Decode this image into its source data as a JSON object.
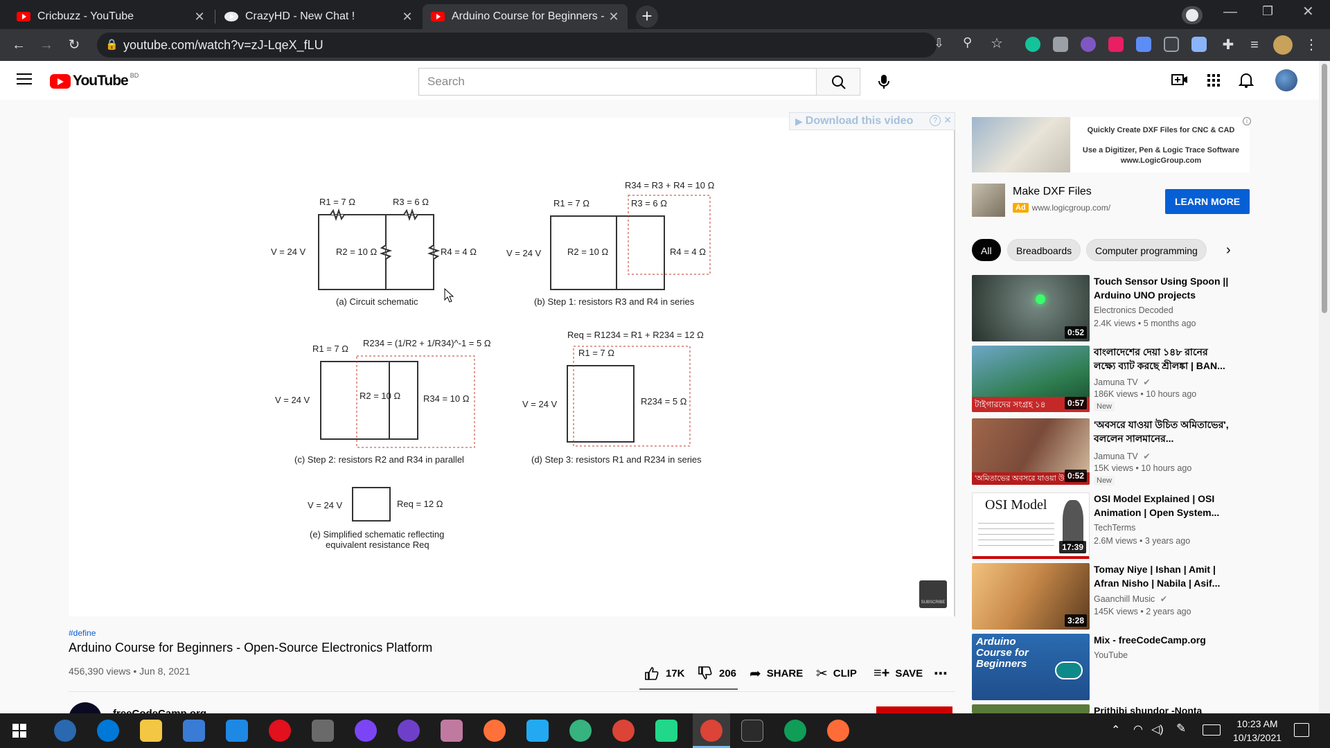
{
  "tabs": [
    {
      "title": "Cricbuzz - YouTube"
    },
    {
      "title": "CrazyHD - New Chat !"
    },
    {
      "title": "Arduino Course for Beginners - O"
    }
  ],
  "omnibox": {
    "url": "youtube.com/watch?v=zJ-LqeX_fLU"
  },
  "youtube": {
    "logo": "YouTube",
    "region": "BD",
    "search_placeholder": "Search"
  },
  "player": {
    "download_label": "Download this video",
    "download_help": "?",
    "diagrams": {
      "a": {
        "r1": "R1 = 7 Ω",
        "r3": "R3 = 6 Ω",
        "v": "V = 24 V",
        "r2": "R2 = 10 Ω",
        "r4": "R4 = 4 Ω",
        "caption": "(a) Circuit schematic"
      },
      "b": {
        "r34": "R34 = R3 + R4 = 10 Ω",
        "r1": "R1 = 7 Ω",
        "r3": "R3 = 6 Ω",
        "v": "V = 24 V",
        "r2": "R2 = 10 Ω",
        "r4": "R4 = 4 Ω",
        "caption": "(b) Step 1: resistors R3 and R4 in series"
      },
      "c": {
        "r1": "R1 = 7 Ω",
        "r234": "R234 = (1/R2 + 1/R34)^-1 = 5 Ω",
        "v": "V = 24 V",
        "r2": "R2 = 10 Ω",
        "r34": "R34 = 10 Ω",
        "caption": "(c) Step 2: resistors R2 and R34 in parallel"
      },
      "d": {
        "req": "Req = R1234 = R1 + R234 = 12 Ω",
        "r1": "R1 = 7 Ω",
        "v": "V = 24 V",
        "r234": "R234 = 5 Ω",
        "caption": "(d) Step 3: resistors R1 and R234 in series"
      },
      "e": {
        "v": "V = 24 V",
        "req": "Req = 12 Ω",
        "caption_1": "(e) Simplified schematic reflecting",
        "caption_2": "equivalent resistance Req"
      }
    },
    "watermark": "SUBSCRIBE"
  },
  "video": {
    "hashtag": "#define",
    "title": "Arduino Course for Beginners - Open-Source Electronics Platform",
    "views_date": "456,390 views • Jun 8, 2021",
    "likes": "17K",
    "dislikes": "206",
    "share": "SHARE",
    "clip": "CLIP",
    "save": "SAVE",
    "channel": "freeCodeCamp.org"
  },
  "ad": {
    "banner_line1": "Quickly Create DXF Files for CNC & CAD",
    "banner_line2": "Use a Digitizer, Pen & Logic Trace Software",
    "banner_line3": "www.LogicGroup.com",
    "title": "Make DXF Files",
    "badge": "Ad",
    "domain": "www.logicgroup.com/",
    "cta": "LEARN MORE"
  },
  "chips": [
    "All",
    "Breadboards",
    "Computer programming"
  ],
  "recommendations": [
    {
      "title": "Touch Sensor Using Spoon || Arduino UNO projects",
      "channel": "Electronics Decoded",
      "meta": "2.4K views • 5 months ago",
      "duration": "0:52",
      "verified": false,
      "new": false,
      "color": "#3b4a3f"
    },
    {
      "title": "বাংলাদেশের দেয়া ১৪৮ রানের লক্ষ্যে ব্যাট করছে শ্রীলঙ্কা | BAN...",
      "channel": "Jamuna TV",
      "meta": "186K views • 10 hours ago",
      "duration": "0:57",
      "verified": true,
      "new": true,
      "badge": "New",
      "thumb_text": "টাইগারদের সংগ্রহ ১৪",
      "color": "#2e7d4f"
    },
    {
      "title": "'অবসরে যাওয়া উচিত অমিতাভের', বললেন সালমানের...",
      "channel": "Jamuna TV",
      "meta": "15K views • 10 hours ago",
      "duration": "0:52",
      "verified": true,
      "new": true,
      "badge": "New",
      "thumb_text": "'অমিতাভের অবসরে যাওয়া উ",
      "color": "#7a4b3a"
    },
    {
      "title": "OSI Model Explained | OSI Animation | Open System...",
      "channel": "TechTerms",
      "meta": "2.6M views • 3 years ago",
      "duration": "17:39",
      "verified": false,
      "new": false,
      "thumb_text": "OSI Model",
      "color": "#ffffff"
    },
    {
      "title": "Tomay Niye | Ishan | Amit | Afran Nisho | Nabila | Asif...",
      "channel": "Gaanchill Music",
      "meta": "145K views • 2 years ago",
      "duration": "3:28",
      "verified": true,
      "new": false,
      "color": "#c98a4a"
    },
    {
      "title": "Mix - freeCodeCamp.org",
      "channel": "YouTube",
      "meta": "",
      "duration": "",
      "verified": false,
      "new": false,
      "thumb_text": "Arduino Course for Beginners",
      "color": "#1f4e8c"
    },
    {
      "title": "Prithibi shundor -Nonta Biskut",
      "channel": "",
      "meta": "",
      "duration": "",
      "color": "#5a7a3a"
    }
  ],
  "taskbar": {
    "time": "10:23 AM",
    "date": "10/13/2021"
  }
}
